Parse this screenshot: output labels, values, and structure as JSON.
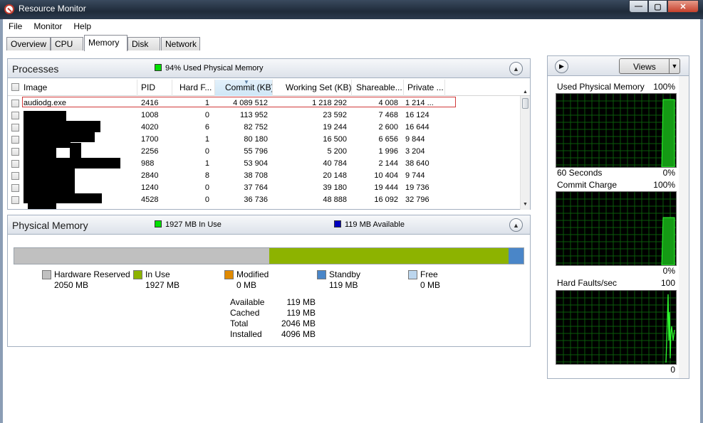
{
  "window": {
    "title": "Resource Monitor"
  },
  "menu": [
    "File",
    "Monitor",
    "Help"
  ],
  "tabs": [
    {
      "label": "Overview"
    },
    {
      "label": "CPU"
    },
    {
      "label": "Memory"
    },
    {
      "label": "Disk"
    },
    {
      "label": "Network"
    }
  ],
  "processes": {
    "title": "Processes",
    "status": "94% Used Physical Memory",
    "status_color": "#00e000",
    "columns": [
      "Image",
      "PID",
      "Hard F...",
      "Commit (KB)",
      "Working Set (KB)",
      "Shareable...",
      "Private ..."
    ],
    "rows": [
      {
        "image": "audiodg.exe",
        "pid": "2416",
        "hard": "1",
        "commit": "4 089 512",
        "ws": "1 218 292",
        "share": "4 008",
        "priv": "1 214 ..."
      },
      {
        "image": "",
        "pid": "1008",
        "hard": "0",
        "commit": "113 952",
        "ws": "23 592",
        "share": "7 468",
        "priv": "16 124"
      },
      {
        "image": "",
        "pid": "4020",
        "hard": "6",
        "commit": "82 752",
        "ws": "19 244",
        "share": "2 600",
        "priv": "16 644"
      },
      {
        "image": "",
        "pid": "1700",
        "hard": "1",
        "commit": "80 180",
        "ws": "16 500",
        "share": "6 656",
        "priv": "9 844"
      },
      {
        "image": "",
        "pid": "2256",
        "hard": "0",
        "commit": "55 796",
        "ws": "5 200",
        "share": "1 996",
        "priv": "3 204"
      },
      {
        "image": "",
        "pid": "988",
        "hard": "1",
        "commit": "53 904",
        "ws": "40 784",
        "share": "2 144",
        "priv": "38 640"
      },
      {
        "image": "",
        "pid": "2840",
        "hard": "8",
        "commit": "38 708",
        "ws": "20 148",
        "share": "10 404",
        "priv": "9 744"
      },
      {
        "image": "",
        "pid": "1240",
        "hard": "0",
        "commit": "37 764",
        "ws": "39 180",
        "share": "19 444",
        "priv": "19 736"
      },
      {
        "image": "",
        "pid": "4528",
        "hard": "0",
        "commit": "36 736",
        "ws": "48 888",
        "share": "16 092",
        "priv": "32 796"
      }
    ]
  },
  "physical_memory": {
    "title": "Physical Memory",
    "in_use_label": "1927 MB In Use",
    "in_use_color": "#00e000",
    "available_label": "119 MB Available",
    "available_color": "#0000c0",
    "bar": [
      {
        "name": "hardware-reserved",
        "value_mb": 2050,
        "color": "#c0c0c0"
      },
      {
        "name": "in-use",
        "value_mb": 1927,
        "color": "#8db300"
      },
      {
        "name": "modified",
        "value_mb": 0,
        "color": "#e08a00"
      },
      {
        "name": "standby",
        "value_mb": 119,
        "color": "#4a86c8"
      },
      {
        "name": "free",
        "value_mb": 0,
        "color": "#bcd6ee"
      }
    ],
    "legend": [
      {
        "label": "Hardware Reserved",
        "value": "2050 MB",
        "color": "#c0c0c0"
      },
      {
        "label": "In Use",
        "value": "1927 MB",
        "color": "#8db300"
      },
      {
        "label": "Modified",
        "value": "0 MB",
        "color": "#e08a00"
      },
      {
        "label": "Standby",
        "value": "119 MB",
        "color": "#4a86c8"
      },
      {
        "label": "Free",
        "value": "0 MB",
        "color": "#bcd6ee"
      }
    ],
    "summary": [
      {
        "key": "Available",
        "value": "119 MB"
      },
      {
        "key": "Cached",
        "value": "119 MB"
      },
      {
        "key": "Total",
        "value": "2046 MB"
      },
      {
        "key": "Installed",
        "value": "4096 MB"
      }
    ]
  },
  "side_panel": {
    "views_label": "Views",
    "graphs": [
      {
        "title": "Used Physical Memory",
        "max": "100%",
        "min": "0%",
        "time": "60 Seconds"
      },
      {
        "title": "Commit Charge",
        "max": "100%",
        "min": "0%",
        "time": ""
      },
      {
        "title": "Hard Faults/sec",
        "max": "100",
        "min": "0",
        "time": ""
      }
    ]
  }
}
